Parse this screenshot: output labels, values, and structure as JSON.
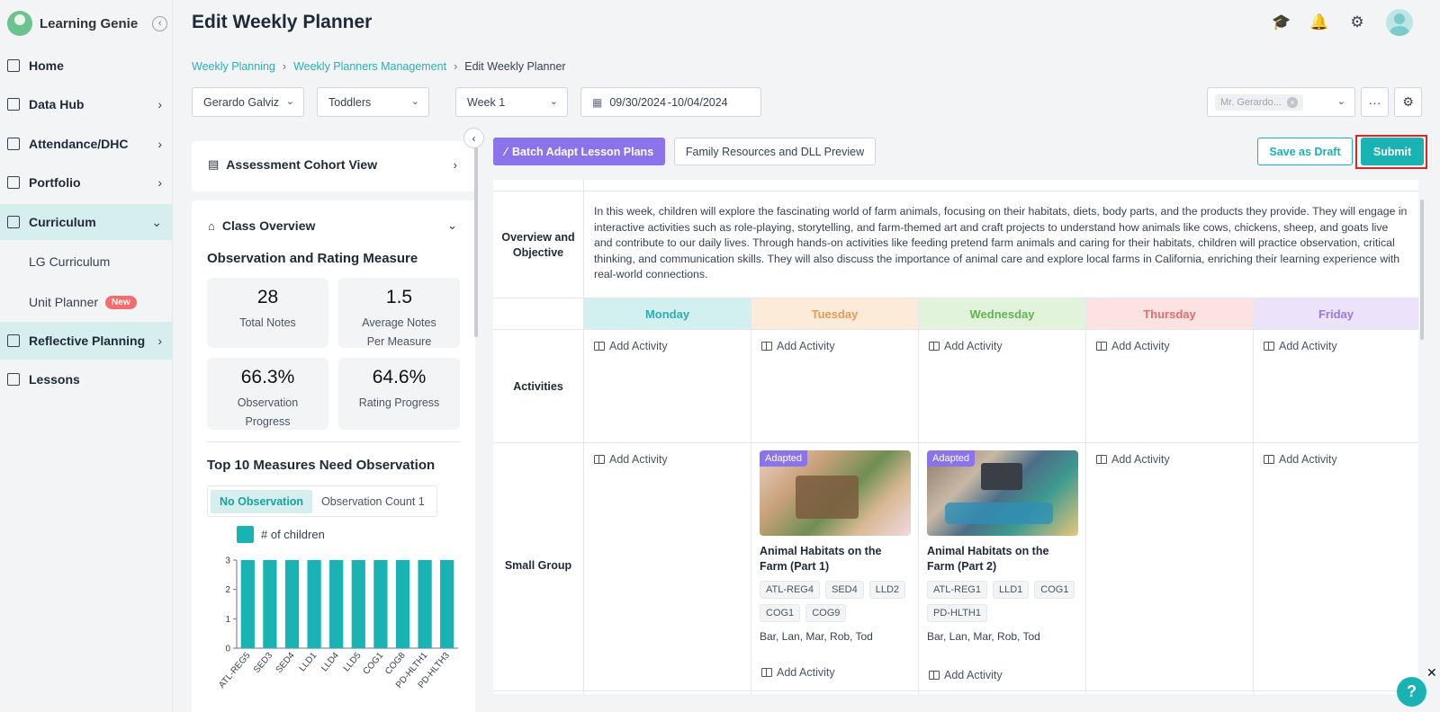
{
  "brand": {
    "name": "Learning Genie"
  },
  "header": {
    "title": "Edit Weekly Planner"
  },
  "sidebar": {
    "items": [
      {
        "label": "Home",
        "icon": "home-icon"
      },
      {
        "label": "Data Hub",
        "icon": "chart-icon"
      },
      {
        "label": "Attendance/DHC",
        "icon": "calendar-icon"
      },
      {
        "label": "Portfolio",
        "icon": "portfolio-icon"
      },
      {
        "label": "Curriculum",
        "icon": "curriculum-icon"
      },
      {
        "label": "Reflective Planning",
        "icon": "planning-icon"
      },
      {
        "label": "Lessons",
        "icon": "lessons-icon"
      }
    ],
    "sub_items": [
      {
        "label": "LG Curriculum"
      },
      {
        "label": "Unit Planner",
        "badge": "New"
      }
    ]
  },
  "breadcrumb": {
    "items": [
      "Weekly Planning",
      "Weekly Planners Management",
      "Edit Weekly Planner"
    ]
  },
  "filters": {
    "teacher": "Gerardo Galviz",
    "group": "Toddlers",
    "week": "Week 1",
    "date_start": "09/30/2024",
    "date_end": "-10/04/2024",
    "assignee": "Mr. Gerardo..."
  },
  "left_panel": {
    "cohort_view": "Assessment Cohort View",
    "class_overview": "Class Overview",
    "measure_title": "Observation and Rating Measure",
    "stats": [
      {
        "value": "28",
        "label": "Total Notes"
      },
      {
        "value": "1.5",
        "label": "Average Notes Per Measure"
      },
      {
        "value": "66.3%",
        "label": "Observation Progress"
      },
      {
        "value": "64.6%",
        "label": "Rating Progress"
      }
    ],
    "top_measures_title": "Top 10 Measures Need Observation",
    "toggle": [
      "No Observation",
      "Observation Count 1"
    ],
    "legend": "# of children"
  },
  "chart_data": {
    "type": "bar",
    "categories": [
      "ATL-REG5",
      "SED3",
      "SED4",
      "LLD1",
      "LLD4",
      "LLD5",
      "COG1",
      "COG8",
      "PD-HLTH1",
      "PD-HLTH3"
    ],
    "values": [
      3,
      3,
      3,
      3,
      3,
      3,
      3,
      3,
      3,
      3
    ],
    "series": [
      {
        "name": "# of children",
        "values": [
          3,
          3,
          3,
          3,
          3,
          3,
          3,
          3,
          3,
          3
        ]
      }
    ],
    "ylim": [
      0,
      3
    ],
    "yticks": [
      "0",
      "1",
      "2",
      "3"
    ],
    "color": "#1ab3b3",
    "grid": false,
    "legend_position": "top-left"
  },
  "toolbar": {
    "batch_adapt": "Batch Adapt Lesson Plans",
    "family_resources": "Family Resources and DLL Preview",
    "save_draft": "Save as Draft",
    "submit": "Submit"
  },
  "planner": {
    "overview_label": "Overview and Objective",
    "overview_text": "In this week, children will explore the fascinating world of farm animals, focusing on their habitats, diets, body parts, and the products they provide. They will engage in interactive activities such as role-playing, storytelling, and farm-themed art and craft projects to understand how animals like cows, chickens, sheep, and goats live and contribute to our daily lives. Through hands-on activities like feeding pretend farm animals and caring for their habitats, children will practice observation, critical thinking, and communication skills. They will also discuss the importance of animal care and explore local farms in California, enriching their learning experience with real-world connections.",
    "days": [
      {
        "label": "Monday",
        "color": "#2ab0b0",
        "bg": "#d3f0f0"
      },
      {
        "label": "Tuesday",
        "color": "#e89a55",
        "bg": "#fdebd9"
      },
      {
        "label": "Wednesday",
        "color": "#5fb54f",
        "bg": "#e2f3dc"
      },
      {
        "label": "Thursday",
        "color": "#e26d6d",
        "bg": "#fde2e2"
      },
      {
        "label": "Friday",
        "color": "#9a78e0",
        "bg": "#ece3fb"
      }
    ],
    "activities_label": "Activities",
    "small_group_label": "Small Group",
    "add_activity": "Add Activity",
    "lessons": [
      {
        "badge": "Adapted",
        "title": "Animal Habitats on the Farm (Part 1)",
        "chips": [
          "ATL-REG4",
          "SED4",
          "LLD2",
          "COG1",
          "COG9"
        ],
        "children": "Bar, Lan, Mar, Rob, Tod"
      },
      {
        "badge": "Adapted",
        "title": "Animal Habitats on the Farm (Part 2)",
        "chips": [
          "ATL-REG1",
          "LLD1",
          "COG1",
          "PD-HLTH1"
        ],
        "children": "Bar, Lan, Mar, Rob, Tod"
      }
    ]
  },
  "help": {
    "label": "?"
  }
}
